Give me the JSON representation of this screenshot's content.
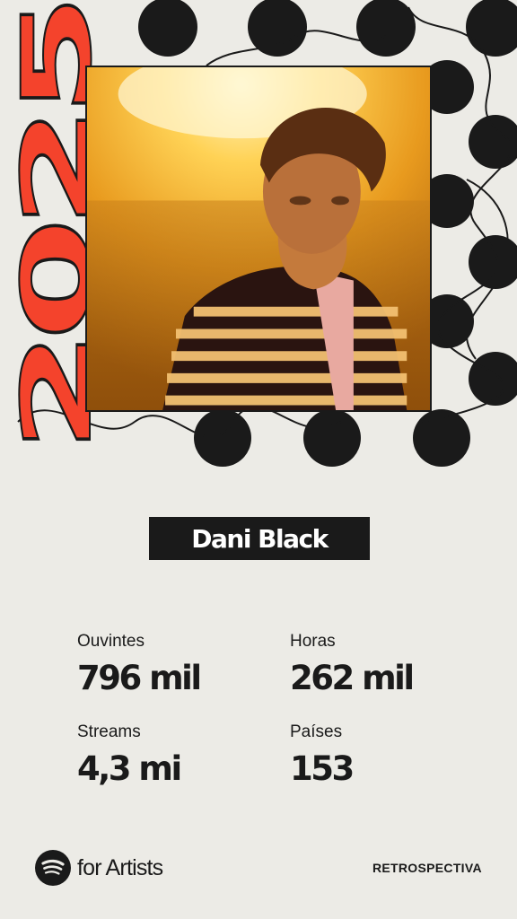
{
  "year": "2025",
  "artist": {
    "name": "Dani Black"
  },
  "stats": [
    {
      "label": "Ouvintes",
      "value": "796 mil"
    },
    {
      "label": "Horas",
      "value": "262 mil"
    },
    {
      "label": "Streams",
      "value": "4,3 mi"
    },
    {
      "label": "Países",
      "value": "153"
    }
  ],
  "footer": {
    "brand": "for Artists",
    "tag": "RETROSPECTIVA"
  },
  "colors": {
    "background": "#ecebe6",
    "accent_red": "#f4432c",
    "dark": "#1a1a1a"
  },
  "icons": [
    "spotify-logo-icon"
  ]
}
